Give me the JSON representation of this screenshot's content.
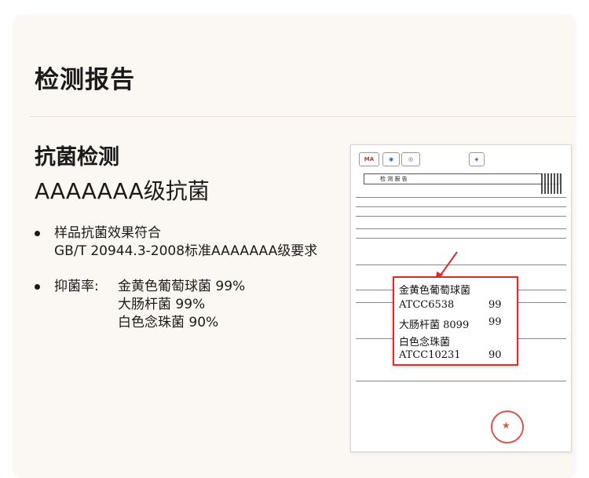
{
  "header": {
    "title": "检测报告"
  },
  "section": {
    "subtitle": "抗菌检测",
    "grade": "AAAAAAA级抗菌",
    "bullet1": {
      "line1": "样品抗菌效果符合",
      "line2": "GB/T 20944.3-2008标准AAAAAAA级要求"
    },
    "bullet2": {
      "label": "抑菌率:",
      "items": [
        "金黄色葡萄球菌  99%",
        "大肠杆菌  99%",
        "白色念珠菌  90%"
      ]
    }
  },
  "report": {
    "doc_title": "检 测 报 告",
    "callout": {
      "rows": [
        {
          "name": "金黄色葡萄球菌",
          "value": ""
        },
        {
          "name": "ATCC6538",
          "value": "99"
        },
        {
          "name": "大肠杆菌 8099",
          "value": "99"
        },
        {
          "name": "白色念珠菌",
          "value": ""
        },
        {
          "name": "ATCC10231",
          "value": "90"
        }
      ]
    },
    "accent_color": "#d32f2f"
  }
}
